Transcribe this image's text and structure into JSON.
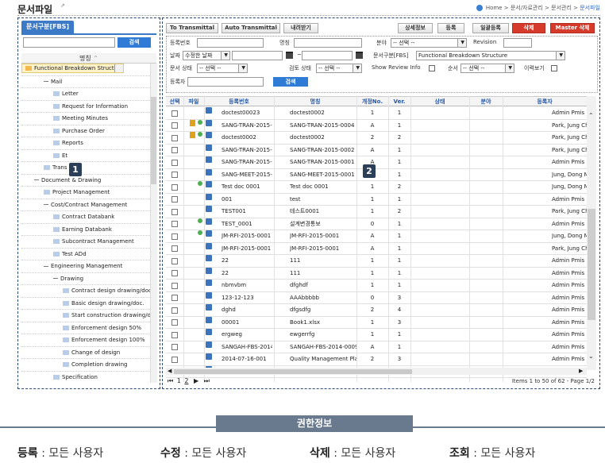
{
  "header": {
    "title": "문서파일",
    "ext_icon": "external-link-icon",
    "breadcrumb": [
      "Home",
      "문서/자료관리",
      "문서관리",
      "문서파일"
    ]
  },
  "left_panel": {
    "tab": "문서구분[FBS]",
    "search_button": "검색",
    "column": "명칭",
    "badge": "1",
    "tree": [
      {
        "label": "Functional Breakdown Structure",
        "level": 0,
        "type": "folder",
        "selected": true
      },
      {
        "label": "Official Documents",
        "level": 1,
        "type": "dash"
      },
      {
        "label": "Mail",
        "level": 2,
        "type": "dash"
      },
      {
        "label": "Letter",
        "level": 3,
        "type": "doc"
      },
      {
        "label": "Request for Information",
        "level": 3,
        "type": "doc"
      },
      {
        "label": "Meeting Minutes",
        "level": 3,
        "type": "doc"
      },
      {
        "label": "Purchase Order",
        "level": 3,
        "type": "doc"
      },
      {
        "label": "Reports",
        "level": 3,
        "type": "doc"
      },
      {
        "label": "Et",
        "level": 3,
        "type": "doc"
      },
      {
        "label": "Trans",
        "level": 2,
        "type": "doc"
      },
      {
        "label": "Document & Drawing",
        "level": 1,
        "type": "dash"
      },
      {
        "label": "Project Management",
        "level": 2,
        "type": "doc"
      },
      {
        "label": "Cost/Contract Management",
        "level": 2,
        "type": "dash"
      },
      {
        "label": "Contract Databank",
        "level": 3,
        "type": "doc"
      },
      {
        "label": "Earning Databank",
        "level": 3,
        "type": "doc"
      },
      {
        "label": "Subcontract Management",
        "level": 3,
        "type": "doc"
      },
      {
        "label": "Test ADd",
        "level": 3,
        "type": "doc"
      },
      {
        "label": "Engineering Management",
        "level": 2,
        "type": "dash"
      },
      {
        "label": "Drawing",
        "level": 3,
        "type": "dash"
      },
      {
        "label": "Contract design drawing/doc.",
        "level": 4,
        "type": "doc"
      },
      {
        "label": "Basic design drawing/doc.",
        "level": 4,
        "type": "doc"
      },
      {
        "label": "Start construction drawing/doc",
        "level": 4,
        "type": "doc"
      },
      {
        "label": "Enforcement design 50%",
        "level": 4,
        "type": "doc"
      },
      {
        "label": "Enforcement design 100%",
        "level": 4,
        "type": "doc"
      },
      {
        "label": "Change of design",
        "level": 4,
        "type": "doc"
      },
      {
        "label": "Completion drawing",
        "level": 4,
        "type": "doc"
      },
      {
        "label": "Specification",
        "level": 3,
        "type": "doc"
      }
    ]
  },
  "right_panel": {
    "badge": "2",
    "buttons": {
      "to_transmittal": "To Transmittal",
      "auto_transmittal": "Auto Transmittal",
      "download": "내려받기",
      "detail": "상세정보",
      "register": "등록",
      "bulk_register": "일괄등록",
      "delete": "삭제",
      "master_delete": "Master 삭제"
    },
    "form": {
      "reg_no": "등록번호",
      "name": "명칭",
      "field": "분야",
      "field_value": "-- 선택 --",
      "revision": "Revision",
      "date": "날짜",
      "date_value": "수정한 날짜",
      "date_sep": "~",
      "doc_class": "문서구분[FBS]",
      "doc_class_value": "Functional Breakdown Structure",
      "doc_status": "문서 상태",
      "doc_status_value": "-- 선택 --",
      "review_status": "검토 상태",
      "review_status_value": "-- 선택 --",
      "show_review": "Show Review Info",
      "order": "순서",
      "order_value": "-- 선택 --",
      "history": "이력보기",
      "registrant": "등록자",
      "search": "검색"
    },
    "columns": [
      "선택",
      "파일",
      "등록번호",
      "명칭",
      "개정No.",
      "Ver.",
      "상태",
      "분야",
      "등록자"
    ],
    "rows": [
      {
        "no": "doctest00023",
        "name": "doctest0002",
        "rev": "1",
        "ver": "1",
        "user": "Admin Pmis",
        "lock": false,
        "dot": false
      },
      {
        "no": "SANG-TRAN-2015-0004",
        "name": "SANG-TRAN-2015-0004",
        "rev": "A",
        "ver": "1",
        "user": "Park, Jung Ch",
        "lock": true,
        "dot": true
      },
      {
        "no": "doctest0002",
        "name": "doctest0002",
        "rev": "2",
        "ver": "2",
        "user": "Park, Jung Ch",
        "lock": true,
        "dot": true
      },
      {
        "no": "SANG-TRAN-2015-0002",
        "name": "SANG-TRAN-2015-0002",
        "rev": "A",
        "ver": "1",
        "user": "Park, Jung Ch",
        "lock": false,
        "dot": false
      },
      {
        "no": "SANG-TRAN-2015-0001",
        "name": "SANG-TRAN-2015-0001",
        "rev": "A",
        "ver": "1",
        "user": "Admin Pmis",
        "lock": false,
        "dot": false
      },
      {
        "no": "SANG-MEET-2015-0001",
        "name": "SANG-MEET-2015-0001",
        "rev": "A",
        "ver": "1",
        "user": "Jung, Dong M",
        "lock": false,
        "dot": false
      },
      {
        "no": "Test doc 0001",
        "name": "Test doc 0001",
        "rev": "1",
        "ver": "2",
        "user": "Jung, Dong M",
        "lock": false,
        "dot": true
      },
      {
        "no": "001",
        "name": "test",
        "rev": "1",
        "ver": "1",
        "user": "Admin Pmis",
        "lock": false,
        "dot": false
      },
      {
        "no": "TEST001",
        "name": "테스트0001",
        "rev": "1",
        "ver": "2",
        "user": "Park, Jung Ch",
        "lock": false,
        "dot": false
      },
      {
        "no": "TEST_0001",
        "name": "설계변경통보",
        "rev": "0",
        "ver": "1",
        "user": "Admin Pmis",
        "lock": false,
        "dot": true
      },
      {
        "no": "JM-RFI-2015-0001",
        "name": "JM-RFI-2015-0001",
        "rev": "A",
        "ver": "1",
        "user": "Jung, Dong M",
        "lock": false,
        "dot": true
      },
      {
        "no": "JM-RFI-2015-0001",
        "name": "JM-RFI-2015-0001",
        "rev": "A",
        "ver": "1",
        "user": "Park, Jung Ch",
        "lock": false,
        "dot": false
      },
      {
        "no": "22",
        "name": "111",
        "rev": "1",
        "ver": "1",
        "user": "Admin Pmis",
        "lock": false,
        "dot": false
      },
      {
        "no": "22",
        "name": "111",
        "rev": "1",
        "ver": "1",
        "user": "Admin Pmis",
        "lock": false,
        "dot": false
      },
      {
        "no": "nbmvbm",
        "name": "dfghdf",
        "rev": "1",
        "ver": "1",
        "user": "Admin Pmis",
        "lock": false,
        "dot": false
      },
      {
        "no": "123-12-123",
        "name": "AAAbbbbb",
        "rev": "0",
        "ver": "3",
        "user": "Admin Pmis",
        "lock": false,
        "dot": false
      },
      {
        "no": "dghd",
        "name": "dfgsdfg",
        "rev": "2",
        "ver": "4",
        "user": "Admin Pmis",
        "lock": false,
        "dot": false
      },
      {
        "no": "00001",
        "name": "Book1.xlsx",
        "rev": "1",
        "ver": "3",
        "user": "Admin Pmis",
        "lock": false,
        "dot": false
      },
      {
        "no": "ergweg",
        "name": "ewgerrfg",
        "rev": "1",
        "ver": "1",
        "user": "Admin Pmis",
        "lock": false,
        "dot": false
      },
      {
        "no": "SANGAH-FBS-2014-0009",
        "name": "SANGAH-FBS-2014-0009",
        "rev": "A",
        "ver": "1",
        "user": "Admin Pmis",
        "lock": false,
        "dot": false
      },
      {
        "no": "2014-07-16-001",
        "name": "Quality Management Plan 1-0 (2.0)",
        "rev": "2",
        "ver": "3",
        "user": "Admin Pmis",
        "lock": false,
        "dot": false
      },
      {
        "no": "sang-fbs-2014-0132",
        "name": "SANG-FBS-2014-0132",
        "rev": "C",
        "ver": "3",
        "user": "Admin Pmis",
        "lock": false,
        "dot": false
      }
    ],
    "pager": {
      "first": "⏮",
      "page1": "1",
      "page2": "2",
      "next": "▶",
      "last": "⏭",
      "items": "Items 1 to 50 of 62 - Page 1/2"
    }
  },
  "permissions": {
    "title": "권한정보",
    "items": [
      {
        "label": "등록",
        "value": "모든 사용자"
      },
      {
        "label": "수정",
        "value": "모든 사용자"
      },
      {
        "label": "삭제",
        "value": "모든 사용자"
      },
      {
        "label": "조회",
        "value": "모든 사용자"
      }
    ]
  }
}
